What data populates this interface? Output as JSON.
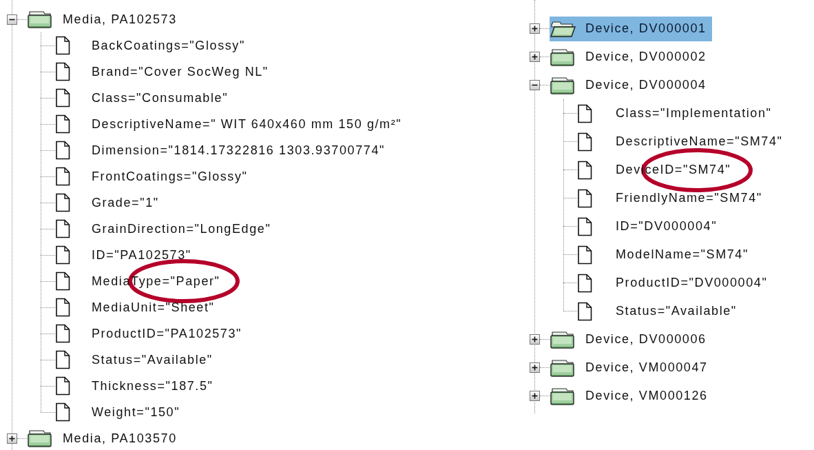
{
  "trees": [
    {
      "nodes": [
        {
          "label": "Media, PA102573",
          "expanded": true,
          "selected": false,
          "children": [
            {
              "label": "BackCoatings=\"Glossy\"",
              "circled": false
            },
            {
              "label": "Brand=\"Cover SocWeg NL\"",
              "circled": false
            },
            {
              "label": "Class=\"Consumable\"",
              "circled": false
            },
            {
              "label": "DescriptiveName=\" WIT 640x460 mm 150 g/m²\"",
              "circled": false
            },
            {
              "label": "Dimension=\"1814.17322816 1303.93700774\"",
              "circled": false
            },
            {
              "label": "FrontCoatings=\"Glossy\"",
              "circled": false
            },
            {
              "label": "Grade=\"1\"",
              "circled": false
            },
            {
              "label": "GrainDirection=\"LongEdge\"",
              "circled": false
            },
            {
              "label": "ID=\"PA102573\"",
              "circled": false
            },
            {
              "label": "MediaType=\"Paper\"",
              "circled": true
            },
            {
              "label": "MediaUnit=\"Sheet\"",
              "circled": false
            },
            {
              "label": "ProductID=\"PA102573\"",
              "circled": false
            },
            {
              "label": "Status=\"Available\"",
              "circled": false
            },
            {
              "label": "Thickness=\"187.5\"",
              "circled": false
            },
            {
              "label": "Weight=\"150\"",
              "circled": false
            }
          ]
        },
        {
          "label": "Media, PA103570",
          "expanded": false,
          "selected": false
        }
      ]
    },
    {
      "nodes": [
        {
          "label": "Device, DV000001",
          "expanded": false,
          "selected": true
        },
        {
          "label": "Device, DV000002",
          "expanded": false,
          "selected": false
        },
        {
          "label": "Device, DV000004",
          "expanded": true,
          "selected": false,
          "children": [
            {
              "label": "Class=\"Implementation\"",
              "circled": false
            },
            {
              "label": "DescriptiveName=\"SM74\"",
              "circled": false
            },
            {
              "label": "DeviceID=\"SM74\"",
              "circled": true
            },
            {
              "label": "FriendlyName=\"SM74\"",
              "circled": false
            },
            {
              "label": "ID=\"DV000004\"",
              "circled": false
            },
            {
              "label": "ModelName=\"SM74\"",
              "circled": false
            },
            {
              "label": "ProductID=\"DV000004\"",
              "circled": false
            },
            {
              "label": "Status=\"Available\"",
              "circled": false
            }
          ]
        },
        {
          "label": "Device, DV000006",
          "expanded": false,
          "selected": false
        },
        {
          "label": "Device, VM000047",
          "expanded": false,
          "selected": false
        },
        {
          "label": "Device, VM000126",
          "expanded": false,
          "selected": false
        }
      ]
    }
  ]
}
